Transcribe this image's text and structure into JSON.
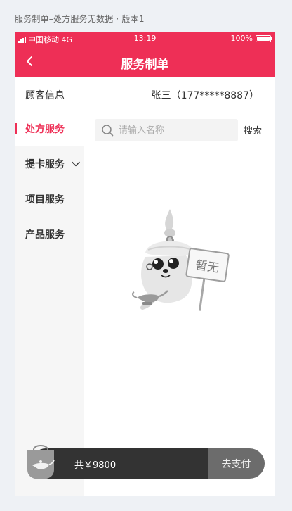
{
  "caption": "服务制单–处方服务无数据 · 版本1",
  "status_bar": {
    "carrier": "中国移动 4G",
    "time": "13:19",
    "battery": "100%"
  },
  "nav": {
    "title": "服务制单",
    "back_icon": "chevron-left-icon"
  },
  "customer": {
    "label": "顾客信息",
    "value": "张三（177*****8887）"
  },
  "side_menu": {
    "items": [
      {
        "label": "处方服务",
        "active": true
      },
      {
        "label": "提卡服务",
        "has_dropdown": true
      },
      {
        "label": "项目服务"
      },
      {
        "label": "产品服务"
      }
    ]
  },
  "search": {
    "placeholder": "请输入名称",
    "button_label": "搜索",
    "icon": "search-icon"
  },
  "empty_state": {
    "sign_text": "暂无"
  },
  "cart": {
    "total_label": "共￥9800",
    "pay_label": "去支付",
    "icon": "shopping-bag-icon"
  },
  "colors": {
    "brand": "#ee2f56",
    "cart_dark": "#333333",
    "pay_disabled": "#6c6c6c"
  }
}
